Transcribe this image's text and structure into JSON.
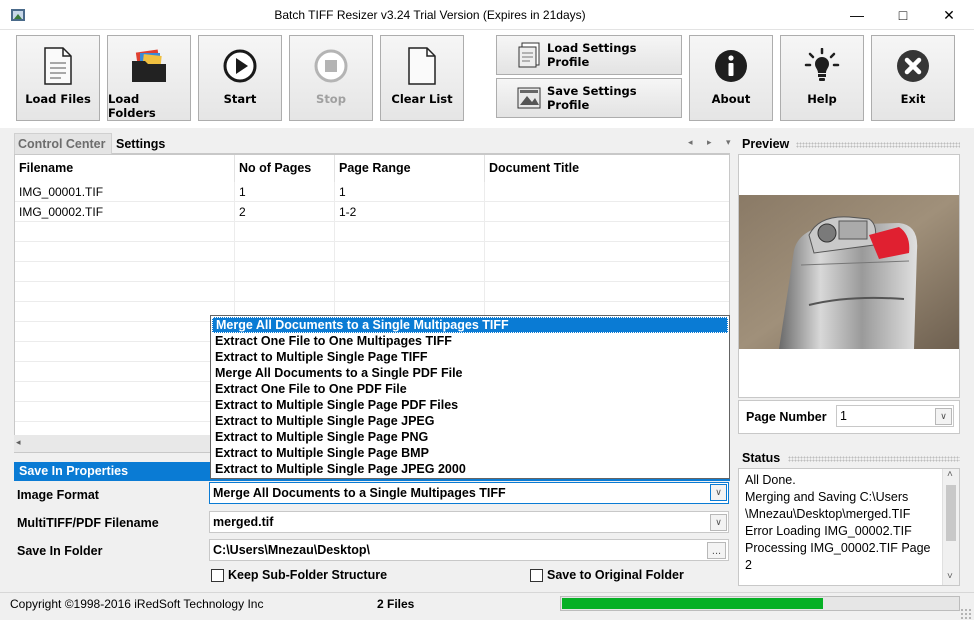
{
  "window": {
    "title": "Batch TIFF Resizer v3.24   Trial Version (Expires in 21days)",
    "minimize_glyph": "—",
    "maximize_glyph": "□",
    "close_glyph": "✕"
  },
  "toolbar": {
    "load_files": "Load Files",
    "load_folders": "Load Folders",
    "start": "Start",
    "stop": "Stop",
    "clear_list": "Clear List",
    "load_settings_profile": "Load Settings Profile",
    "save_settings_profile": "Save Settings Profile",
    "about": "About",
    "help": "Help",
    "exit": "Exit"
  },
  "tabs": {
    "control_center": "Control Center",
    "settings": "Settings",
    "nav": "◂ ▸ ▾"
  },
  "table": {
    "columns": [
      "Filename",
      "No of Pages",
      "Page Range",
      "Document Title"
    ],
    "rows": [
      [
        "IMG_00001.TIF",
        "1",
        "1",
        ""
      ],
      [
        "IMG_00002.TIF",
        "2",
        "1-2",
        ""
      ]
    ],
    "scroll_left_glyph": "◂"
  },
  "save_properties": {
    "header": "Save In Properties",
    "image_format_label": "Image Format",
    "image_format_value": "Merge All Documents to a Single Multipages TIFF",
    "multitiff_label": "MultiTIFF/PDF Filename",
    "multitiff_value": "merged.tif",
    "save_folder_label": "Save In Folder",
    "save_folder_value": "C:\\Users\\Mnezau\\Desktop\\",
    "browse_glyph": "...",
    "dropdown_glyph": "∨",
    "keep_subfolder": "Keep Sub-Folder Structure",
    "save_original": "Save to Original Folder"
  },
  "format_options": [
    "Merge All Documents to a Single Multipages TIFF",
    "Extract One File to One Multipages TIFF",
    "Extract to Multiple Single Page TIFF",
    "Merge All Documents to a Single PDF File",
    "Extract One File to One PDF File",
    "Extract to Multiple Single Page PDF Files",
    "Extract to Multiple Single Page JPEG",
    "Extract to Multiple Single Page PNG",
    "Extract to Multiple Single Page BMP",
    "Extract to Multiple Single Page JPEG 2000"
  ],
  "preview": {
    "header": "Preview",
    "page_number_label": "Page Number",
    "page_number_value": "1"
  },
  "status": {
    "header": "Status",
    "lines": [
      "All Done.",
      "Merging and Saving C:\\Users",
      "\\Mnezau\\Desktop\\merged.TIF",
      "Error Loading IMG_00002.TIF",
      "Processing IMG_00002.TIF Page",
      "2"
    ],
    "scroll_up_glyph": "˄",
    "scroll_down_glyph": "˅"
  },
  "statusbar": {
    "copyright": "Copyright ©1998-2016 iRedSoft Technology Inc",
    "file_count": "2 Files",
    "progress_fraction": 0.66
  },
  "colors": {
    "accent": "#0a7bd4",
    "progress": "#06b025",
    "exit_icon": "#363636"
  }
}
